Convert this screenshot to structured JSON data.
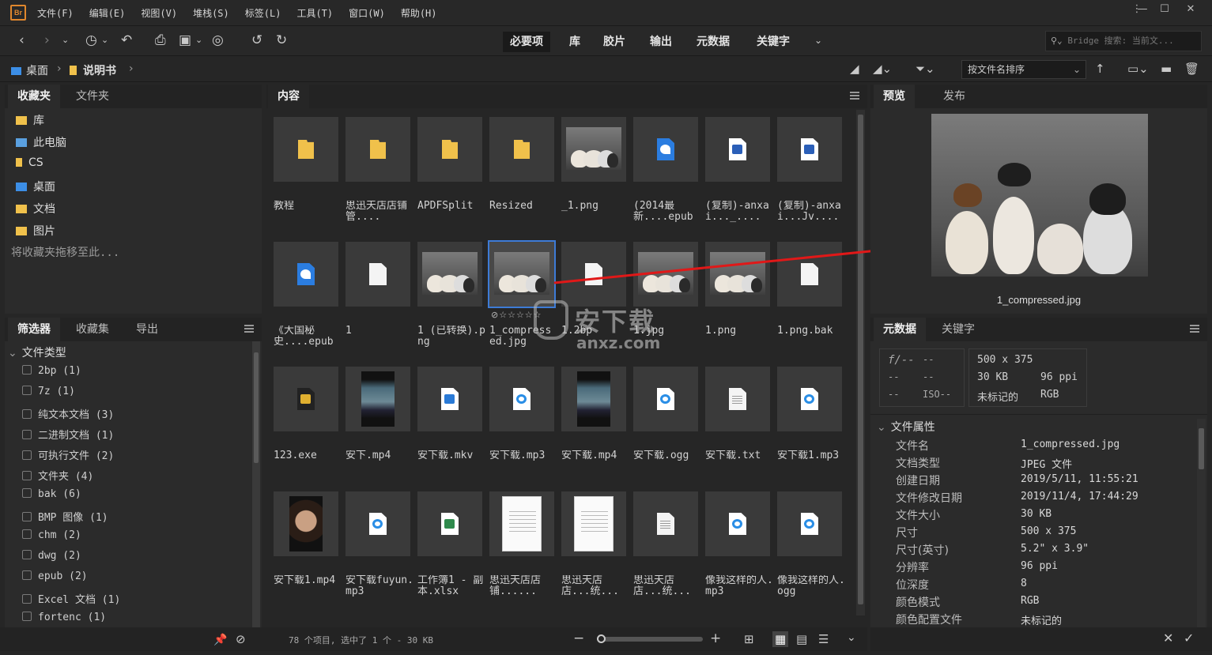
{
  "app": {
    "logo": "Br"
  },
  "menu": [
    "文件(F)",
    "编辑(E)",
    "视图(V)",
    "堆栈(S)",
    "标签(L)",
    "工具(T)",
    "窗口(W)",
    "帮助(H)"
  ],
  "workspaces": [
    "必要项",
    "库",
    "胶片",
    "输出",
    "元数据",
    "关键字"
  ],
  "search": {
    "placeholder": "Bridge 搜索: 当前文..."
  },
  "path": {
    "items": [
      "桌面",
      "说明书"
    ]
  },
  "sort": {
    "label": "按文件名排序"
  },
  "favorites_panel": {
    "tabs": [
      "收藏夹",
      "文件夹"
    ],
    "items": [
      "库",
      "此电脑",
      "CS",
      "桌面",
      "文档",
      "图片"
    ],
    "hint": "将收藏夹拖移至此..."
  },
  "filter_panel": {
    "tabs": [
      "筛选器",
      "收藏集",
      "导出"
    ],
    "section": "文件类型",
    "rows": [
      "2bp  (1)",
      "7z  (1)",
      "纯文本文档  (3)",
      "二进制文档  (1)",
      "可执行文件  (2)",
      "文件夹  (4)",
      "bak  (6)",
      "BMP 图像  (1)",
      "chm  (2)",
      "dwg  (2)",
      "epub  (2)",
      "Excel 文档  (1)",
      "fortenc  (1)"
    ]
  },
  "content_panel": {
    "tab": "内容",
    "items": [
      {
        "label": "教程",
        "kind": "folder-icon"
      },
      {
        "label": "思迅天店店铺管....",
        "kind": "folder-icon"
      },
      {
        "label": "APDFSplit",
        "kind": "folder-icon"
      },
      {
        "label": "Resized",
        "kind": "folder-icon"
      },
      {
        "label": "_1.png",
        "kind": "puppy-thumbnail"
      },
      {
        "label": "(2014最新....epub",
        "kind": "epub-icon"
      },
      {
        "label": "(复制)-anxai..._....",
        "kind": "word-doc-icon"
      },
      {
        "label": "(复制)-anxai...Jv....",
        "kind": "word-doc-icon"
      },
      {
        "label": "《大国秘史....epub",
        "kind": "epub-icon"
      },
      {
        "label": "1",
        "kind": "blank-file-icon"
      },
      {
        "label": "1 (已转换).png",
        "kind": "puppy-thumbnail"
      },
      {
        "label": "1_compressed.jpg",
        "kind": "puppy-thumbnail"
      },
      {
        "label": "1.2bp",
        "kind": "blank-file-icon"
      },
      {
        "label": "1.jpg",
        "kind": "puppy-thumbnail"
      },
      {
        "label": "1.png",
        "kind": "puppy-thumbnail"
      },
      {
        "label": "1.png.bak",
        "kind": "blank-file-icon"
      },
      {
        "label": "123.exe",
        "kind": "exe-icon"
      },
      {
        "label": "安下.mp4",
        "kind": "video-thumbnail"
      },
      {
        "label": "安下载.mkv",
        "kind": "mkv-icon"
      },
      {
        "label": "安下载.mp3",
        "kind": "audio-icon"
      },
      {
        "label": "安下载.mp4",
        "kind": "video-thumbnail"
      },
      {
        "label": "安下载.ogg",
        "kind": "audio-icon"
      },
      {
        "label": "安下载.txt",
        "kind": "text-file-icon"
      },
      {
        "label": "安下载1.mp3",
        "kind": "audio-icon"
      },
      {
        "label": "安下载1.mp4",
        "kind": "portrait-thumbnail"
      },
      {
        "label": "安下载fuyun.mp3",
        "kind": "audio-icon"
      },
      {
        "label": "工作簿1 - 副本.xlsx",
        "kind": "excel-icon"
      },
      {
        "label": "思迅天店店铺......",
        "kind": "document-page-thumbnail"
      },
      {
        "label": "思迅天店店...统...",
        "kind": "document-page-thumbnail"
      },
      {
        "label": "思迅天店店...统...",
        "kind": "text-file-icon"
      },
      {
        "label": "像我这样的人.mp3",
        "kind": "audio-icon"
      },
      {
        "label": "像我这样的人.ogg",
        "kind": "audio-icon"
      }
    ],
    "selected_index": 11,
    "status": "78 个项目, 选中了 1 个 - 30 KB"
  },
  "preview_panel": {
    "tabs": [
      "预览",
      "发布"
    ],
    "filename": "1_compressed.jpg"
  },
  "metadata_panel": {
    "tabs": [
      "元数据",
      "关键字"
    ],
    "camera": {
      "fstop": "f/--",
      "shutter": "--",
      "a": "--",
      "b": "--",
      "c": "--",
      "iso": "ISO--"
    },
    "summary": {
      "dims": "500 x 375",
      "size": "30 KB",
      "ppi": "96 ppi",
      "profile": "未标记的",
      "mode": "RGB"
    },
    "section": "文件属性",
    "rows": [
      {
        "k": "文件名",
        "v": "1_compressed.jpg"
      },
      {
        "k": "文档类型",
        "v": "JPEG 文件"
      },
      {
        "k": "创建日期",
        "v": "2019/5/11, 11:55:21"
      },
      {
        "k": "文件修改日期",
        "v": "2019/11/4, 17:44:29"
      },
      {
        "k": "文件大小",
        "v": "30 KB"
      },
      {
        "k": "尺寸",
        "v": "500 x 375"
      },
      {
        "k": "尺寸(英寸)",
        "v": "5.2\" x 3.9\""
      },
      {
        "k": "分辨率",
        "v": "96 ppi"
      },
      {
        "k": "位深度",
        "v": "8"
      },
      {
        "k": "颜色模式",
        "v": "RGB"
      },
      {
        "k": "颜色配置文件",
        "v": "未标记的"
      }
    ]
  },
  "watermark": {
    "text": "安下载",
    "sub": "anxz.com"
  },
  "colors": {
    "accent": "#3d7bd6",
    "folder": "#f0c14b",
    "arrow": "#e01818",
    "brand": "#e0872d"
  }
}
